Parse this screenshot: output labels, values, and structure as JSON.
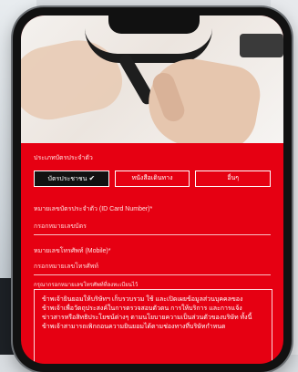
{
  "form": {
    "id_type_label": "ประเภทบัตรประจำตัว",
    "id_type_options": [
      {
        "label": "บัตรประชาชน",
        "selected": true
      },
      {
        "label": "หนังสือเดินทาง",
        "selected": false
      },
      {
        "label": "อื่นๆ",
        "selected": false
      }
    ],
    "id_number_label": "หมายเลขบัตรประจำตัว (ID Card Number)*",
    "id_number_placeholder": "กรอกหมายเลขบัตร",
    "phone_label": "หมายเลขโทรศัพท์ (Mobile)*",
    "phone_placeholder": "กรอกหมายเลขโทรศัพท์",
    "phone_hint": "กรุณากรอกหมายเลขโทรศัพท์ที่ลงทะเบียนไว้",
    "consent_text": "ข้าพเจ้ายินยอมให้บริษัทฯ เก็บรวบรวม ใช้ และเปิดเผยข้อมูลส่วนบุคคลของข้าพเจ้าเพื่อวัตถุประสงค์ในการตรวจสอบตัวตน การให้บริการ และการแจ้งข่าวสารหรือสิทธิประโยชน์ต่างๆ ตามนโยบายความเป็นส่วนตัวของบริษัท ทั้งนี้ข้าพเจ้าสามารถเพิกถอนความยินยอมได้ตามช่องทางที่บริษัทกำหนด"
  },
  "colors": {
    "brand_red": "#e60012",
    "active_segment": "#111111"
  }
}
